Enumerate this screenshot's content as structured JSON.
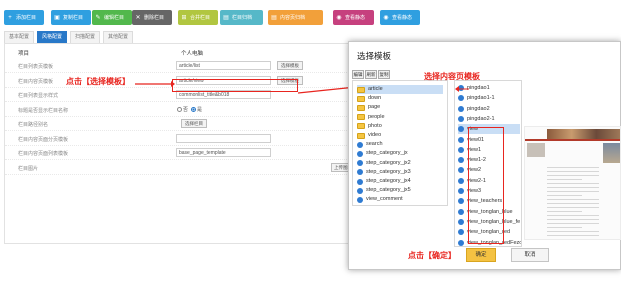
{
  "toolbar": {
    "buttons": [
      {
        "label": "添加栏目",
        "icon": "+",
        "color": "#2f9fe0"
      },
      {
        "label": "复制栏目",
        "icon": "▣",
        "color": "#2f9fe0"
      },
      {
        "label": "编辑栏目",
        "icon": "✎",
        "color": "#52b84c"
      },
      {
        "label": "删除栏目",
        "icon": "✕",
        "color": "#666666"
      },
      {
        "label": "合并栏目",
        "icon": "⊞",
        "color": "#b1c640"
      },
      {
        "label": "栏目归档",
        "icon": "▤",
        "color": "#56b8c8"
      },
      {
        "label": "内容页归档",
        "icon": "▤",
        "color": "#f2a03a"
      },
      {
        "label": "查看静态",
        "icon": "◉",
        "color": "#c6407e"
      },
      {
        "label": "查看静态",
        "icon": "◉",
        "color": "#2f9fe0"
      }
    ]
  },
  "tabs": [
    "基本配置",
    "风格配置",
    "扫描配置",
    "其他配置"
  ],
  "active_tab_index": 1,
  "form": {
    "col_item": "项目",
    "col_personal": "个人电脑",
    "rows": [
      {
        "label": "栏目列表页模板",
        "value": "article/list",
        "button": "选择模板"
      },
      {
        "label": "栏目内容页模板",
        "value": "article/view",
        "button": "选择模板"
      },
      {
        "label": "栏目列表显示样式",
        "value": "commonlist_title&b018"
      },
      {
        "label": "标题是否显示栏目名称",
        "radio_options": [
          "否",
          "是"
        ],
        "radio_selected": 1
      },
      {
        "label": "栏目路径别名",
        "button": "选择栏目"
      },
      {
        "label": "栏目内容页面分页模板"
      },
      {
        "label": "栏目内容页面列表模板",
        "value": "base_page_template"
      },
      {
        "label": "栏目图片",
        "button": "上传图标"
      }
    ]
  },
  "annotations": {
    "click_template": "点击【选择模板】",
    "select_template": "选择内容页模板",
    "click_ok": "点击【确定】"
  },
  "dialog": {
    "title": "选择模板",
    "toolbar": [
      "编辑",
      "刷新",
      "复制"
    ],
    "folders": [
      {
        "name": "article",
        "type": "folder",
        "selected": true
      },
      {
        "name": "down",
        "type": "folder"
      },
      {
        "name": "page",
        "type": "folder"
      },
      {
        "name": "people",
        "type": "folder"
      },
      {
        "name": "photo",
        "type": "folder"
      },
      {
        "name": "video",
        "type": "folder"
      },
      {
        "name": "search",
        "type": "file"
      },
      {
        "name": "step_category_jx",
        "type": "file"
      },
      {
        "name": "step_category_jx2",
        "type": "file"
      },
      {
        "name": "step_category_jx3",
        "type": "file"
      },
      {
        "name": "step_category_jx4",
        "type": "file"
      },
      {
        "name": "step_category_jx5",
        "type": "file"
      },
      {
        "name": "view_comment",
        "type": "file"
      }
    ],
    "files": [
      {
        "name": "pingdao1"
      },
      {
        "name": "pingdao1-1"
      },
      {
        "name": "pingdao2"
      },
      {
        "name": "pingdao2-1"
      },
      {
        "name": "view",
        "selected": true
      },
      {
        "name": "view01"
      },
      {
        "name": "view1"
      },
      {
        "name": "view1-2"
      },
      {
        "name": "view2"
      },
      {
        "name": "view2-1"
      },
      {
        "name": "view3"
      },
      {
        "name": "view_teachers"
      },
      {
        "name": "view_tonglan_blue"
      },
      {
        "name": "view_tonglan_blue_fe"
      },
      {
        "name": "view_tonglan_red"
      },
      {
        "name": "view_tonglan_redFezorwyt"
      }
    ],
    "ok_label": "确定",
    "cancel_label": "取消"
  },
  "colors": {
    "accent": "#2878c8",
    "annotation": "#e8251f",
    "ok_button": "#f4c242"
  }
}
